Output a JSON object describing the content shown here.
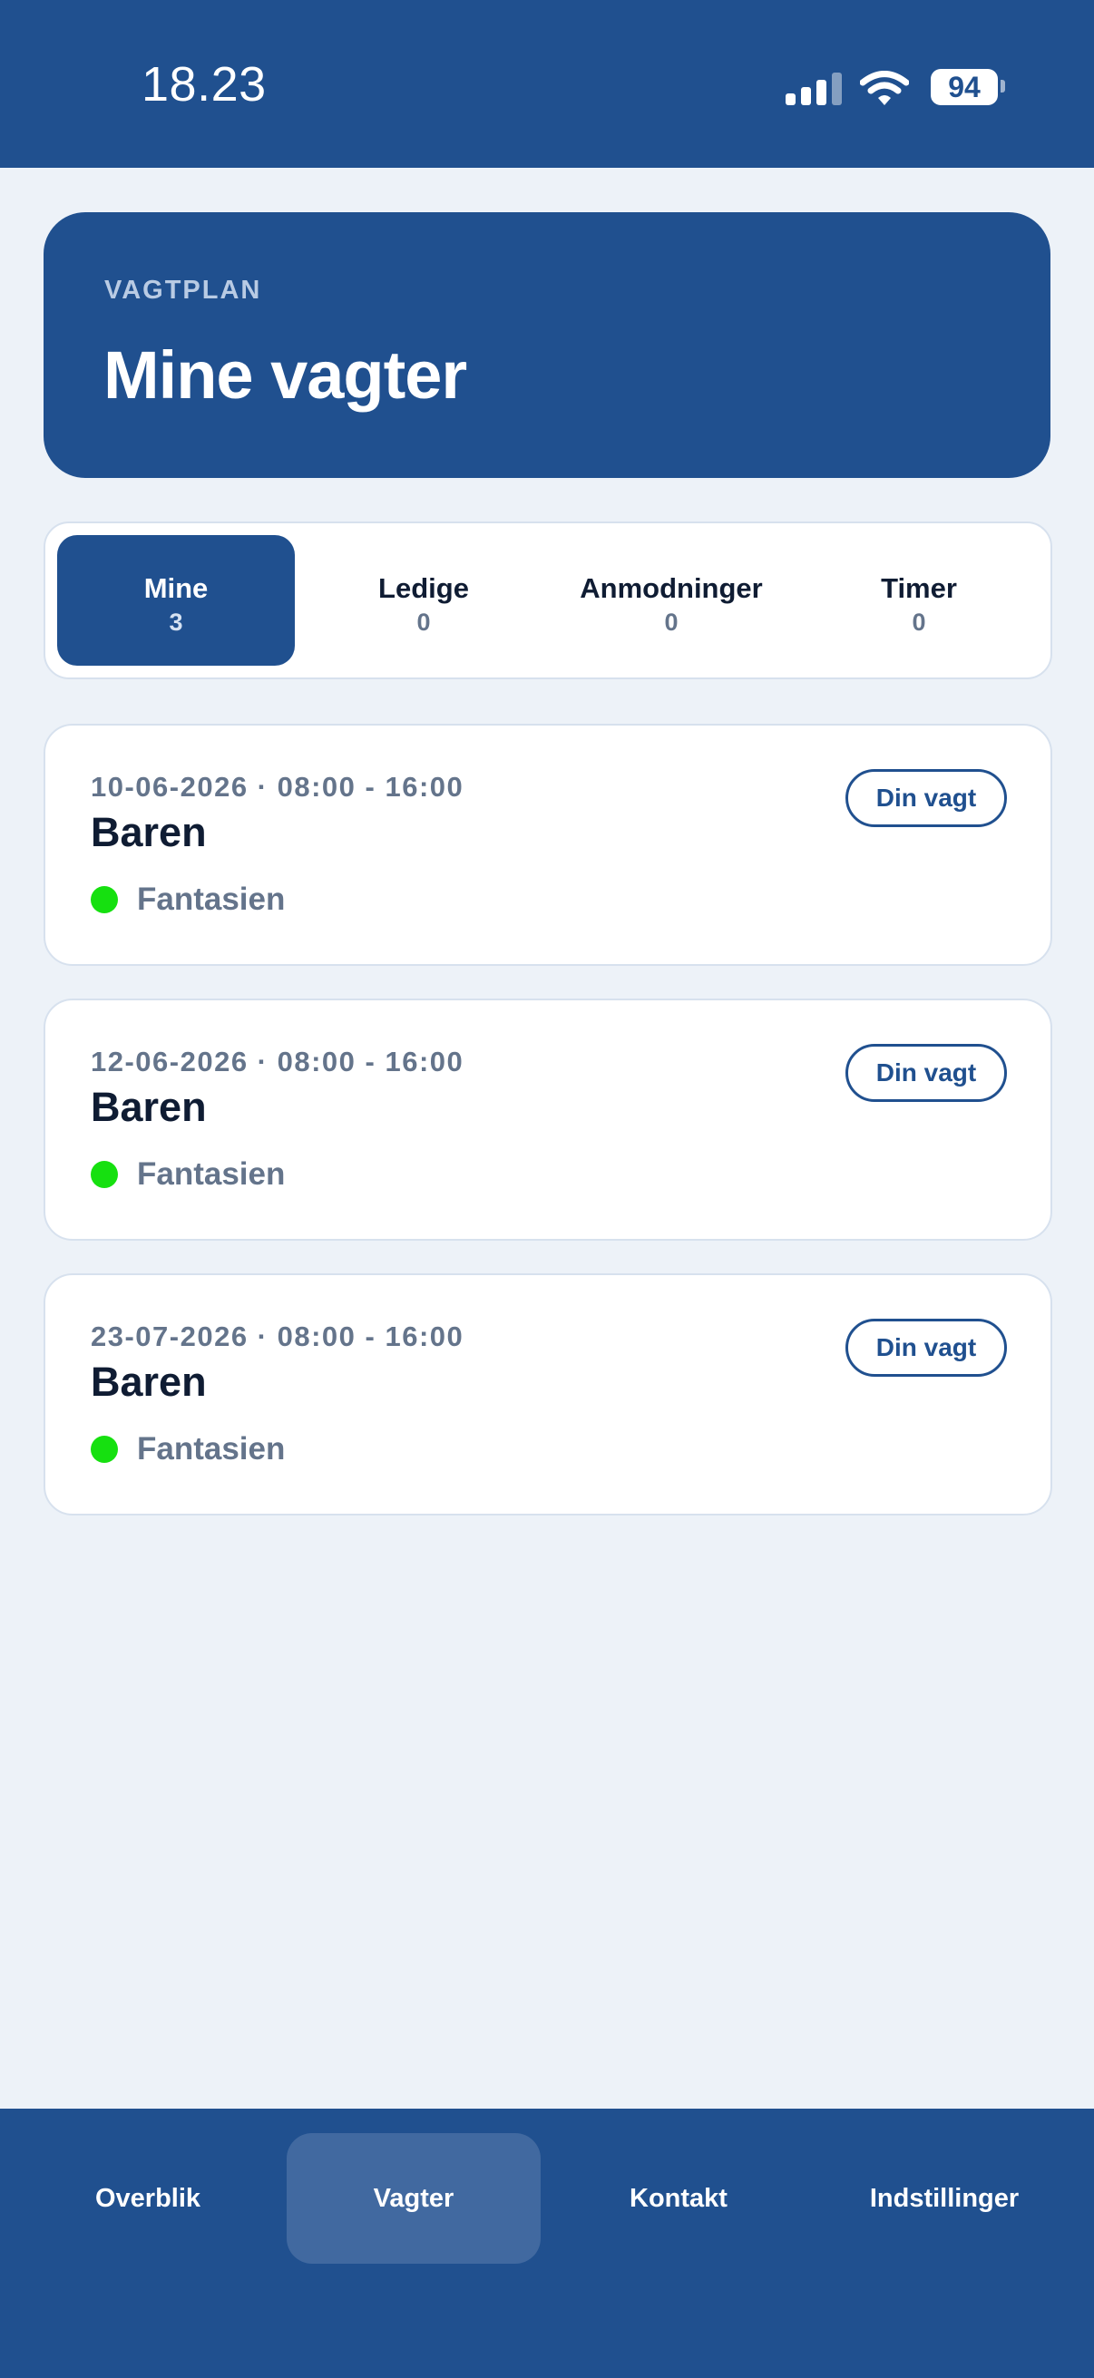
{
  "status_bar": {
    "time": "18.23",
    "battery": "94"
  },
  "header": {
    "eyebrow": "VAGTPLAN",
    "title": "Mine vagter"
  },
  "tabs": [
    {
      "label": "Mine",
      "count": "3",
      "active": true
    },
    {
      "label": "Ledige",
      "count": "0",
      "active": false
    },
    {
      "label": "Anmodninger",
      "count": "0",
      "active": false
    },
    {
      "label": "Timer",
      "count": "0",
      "active": false
    }
  ],
  "shifts": [
    {
      "datetime": "10-06-2026 · 08:00 - 16:00",
      "title": "Baren",
      "location": "Fantasien",
      "badge": "Din vagt"
    },
    {
      "datetime": "12-06-2026 · 08:00 - 16:00",
      "title": "Baren",
      "location": "Fantasien",
      "badge": "Din vagt"
    },
    {
      "datetime": "23-07-2026 · 08:00 - 16:00",
      "title": "Baren",
      "location": "Fantasien",
      "badge": "Din vagt"
    }
  ],
  "bottom_nav": [
    {
      "label": "Overblik",
      "active": false
    },
    {
      "label": "Vagter",
      "active": true
    },
    {
      "label": "Kontakt",
      "active": false
    },
    {
      "label": "Indstillinger",
      "active": false
    }
  ],
  "colors": {
    "brand": "#20508f",
    "background": "#edf2f8",
    "status_dot": "#16e010",
    "muted_text": "#64748b",
    "nav_active": "#4169a0"
  },
  "icons": [
    "signal-icon",
    "wifi-icon",
    "battery-icon",
    "location-dot-icon"
  ]
}
